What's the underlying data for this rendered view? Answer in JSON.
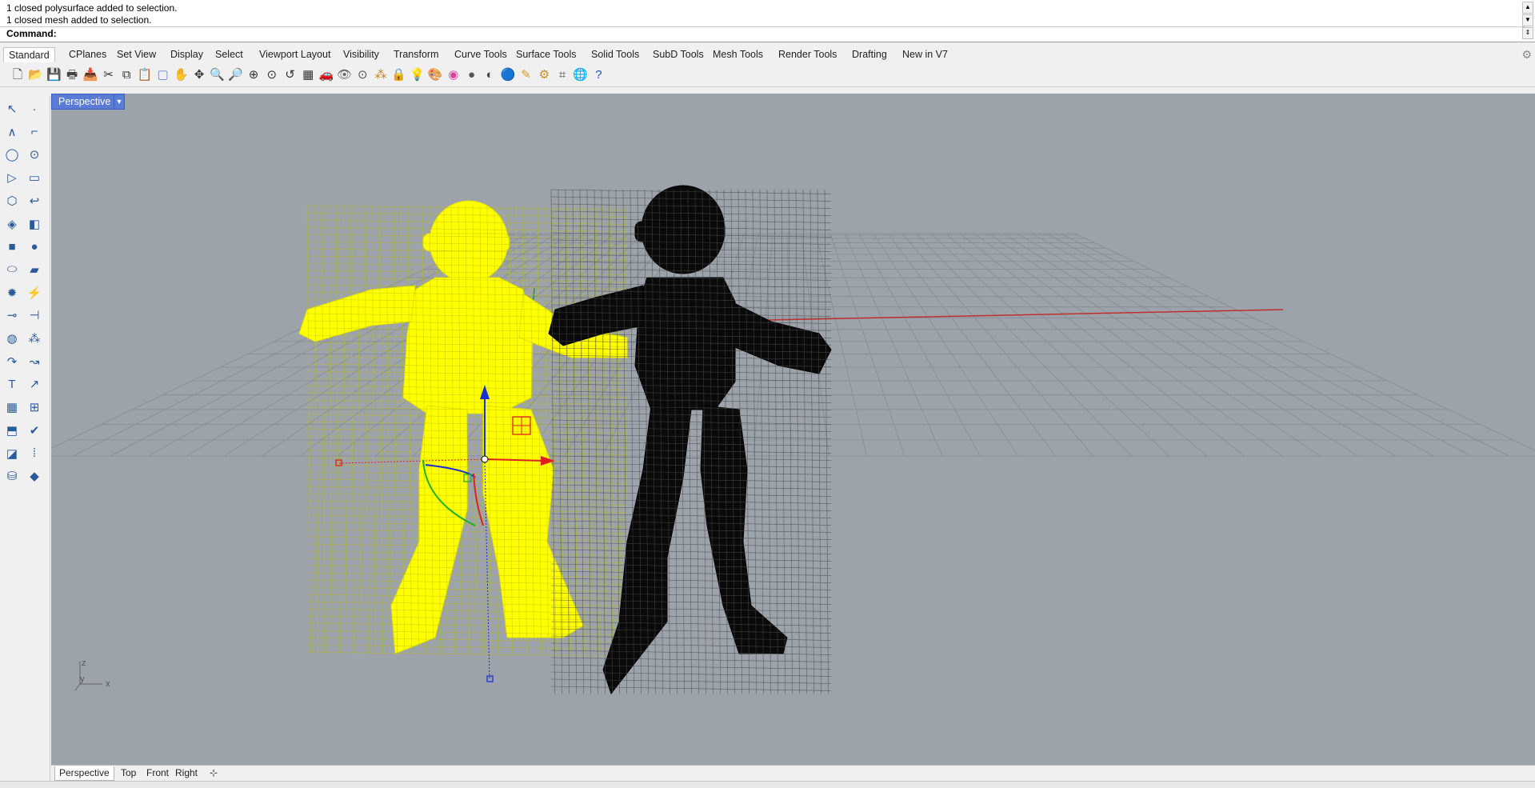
{
  "command_history": [
    "1 closed polysurface added to selection.",
    "1 closed mesh added to selection."
  ],
  "command": {
    "label": "Command:",
    "value": ""
  },
  "tabs": [
    {
      "label": "Standard",
      "active": true
    },
    {
      "label": "CPlanes"
    },
    {
      "label": "Set View"
    },
    {
      "label": "Display"
    },
    {
      "label": "Select"
    },
    {
      "label": "Viewport Layout"
    },
    {
      "label": "Visibility"
    },
    {
      "label": "Transform"
    },
    {
      "label": "Curve Tools"
    },
    {
      "label": "Surface Tools"
    },
    {
      "label": "Solid Tools"
    },
    {
      "label": "SubD Tools"
    },
    {
      "label": "Mesh Tools"
    },
    {
      "label": "Render Tools"
    },
    {
      "label": "Drafting"
    },
    {
      "label": "New in V7"
    }
  ],
  "toolbar_icons": [
    "new-file",
    "open-file",
    "save",
    "print",
    "import",
    "cut",
    "copy",
    "paste",
    "select-window",
    "pan",
    "rotate-view",
    "zoom-dynamic",
    "zoom-window",
    "zoom-extents",
    "zoom-selected",
    "undo-view",
    "four-viewports",
    "car-display",
    "hidden-display",
    "points-on",
    "select-points",
    "lock",
    "light",
    "material",
    "color-wheel",
    "render-sphere",
    "shaded-sphere",
    "render-preview",
    "lamp",
    "gear-properties",
    "grid-snap",
    "globe",
    "help"
  ],
  "left_tool_icons": [
    "select-arrow",
    "point",
    "polyline",
    "curve",
    "circle",
    "ellipse",
    "arc",
    "rectangle",
    "polygon",
    "fillet",
    "surface",
    "extrude",
    "box",
    "sphere",
    "cylinder",
    "plane",
    "explode",
    "mesh",
    "join",
    "split",
    "boolean",
    "group",
    "sweep",
    "loft",
    "text",
    "transform",
    "array",
    "dimension",
    "analyze",
    "check",
    "patch",
    "dots",
    "render",
    "gear"
  ],
  "viewport": {
    "title": "Perspective",
    "background": "#9da3ab",
    "axis_labels": {
      "z": "z",
      "y": "y",
      "x": "x"
    },
    "selected_color": "#ffff00",
    "mesh_color": "#000000"
  },
  "viewport_tabs": [
    {
      "label": "Perspective",
      "active": true
    },
    {
      "label": "Top"
    },
    {
      "label": "Front"
    },
    {
      "label": "Right"
    }
  ]
}
